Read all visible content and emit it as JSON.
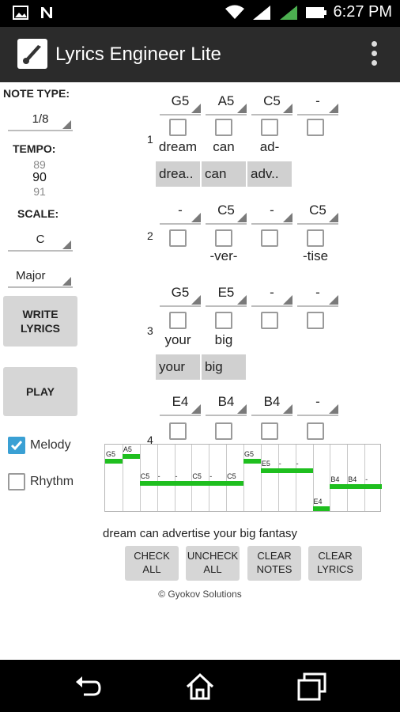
{
  "status": {
    "time": "6:27 PM"
  },
  "app": {
    "title": "Lyrics Engineer Lite"
  },
  "left": {
    "note_type_label": "NOTE TYPE:",
    "note_type_value": "1/8",
    "tempo_label": "TEMPO:",
    "tempo_values": [
      "89",
      "90",
      "91"
    ],
    "scale_label": "SCALE:",
    "scale_key": "C",
    "scale_mode": "Major",
    "write_lyrics": "WRITE\nLYRICS",
    "play": "PLAY",
    "melody_label": "Melody",
    "melody_checked": true,
    "rhythm_label": "Rhythm",
    "rhythm_checked": false
  },
  "rows": [
    {
      "num": "1",
      "notes": [
        "G5",
        "A5",
        "C5",
        "-"
      ],
      "syllables": [
        "dream",
        "can",
        "ad-",
        ""
      ],
      "words": [
        "drea..",
        "can",
        "adv..",
        ""
      ]
    },
    {
      "num": "2",
      "notes": [
        "-",
        "C5",
        "-",
        "C5"
      ],
      "syllables": [
        "",
        "-ver-",
        "",
        "-tise"
      ],
      "words": []
    },
    {
      "num": "3",
      "notes": [
        "G5",
        "E5",
        "-",
        "-"
      ],
      "syllables": [
        "your",
        "big",
        "",
        ""
      ],
      "words": [
        "your",
        "big"
      ]
    },
    {
      "num": "4",
      "notes": [
        "E4",
        "B4",
        "B4",
        "-"
      ],
      "syllables": [],
      "words": []
    }
  ],
  "roll": {
    "labels": [
      "G5",
      "A5",
      "C5",
      "-",
      "-",
      "C5",
      "-",
      "C5",
      "G5",
      "E5",
      "-",
      "-",
      "E4",
      "B4",
      "B4",
      "-"
    ]
  },
  "summary": "dream can advertise your big fantasy",
  "buttons": {
    "check_all": "CHECK\nALL",
    "uncheck_all": "UNCHECK\nALL",
    "clear_notes": "CLEAR\nNOTES",
    "clear_lyrics": "CLEAR\nLYRICS"
  },
  "copyright": "© Gyokov Solutions",
  "colors": {
    "accent": "#3aa0d4",
    "roll_bar": "#1fbf1f",
    "actionbar": "#2b2b2b"
  }
}
